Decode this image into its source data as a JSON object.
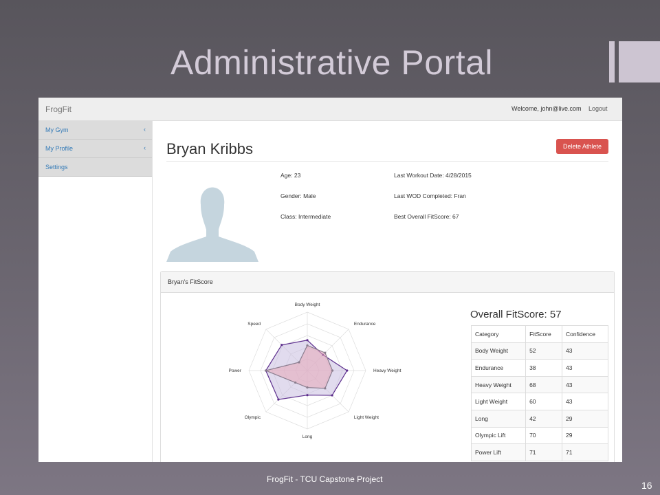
{
  "slide": {
    "title": "Administrative Portal",
    "footer": "FrogFit - TCU Capstone Project",
    "page_number": "16",
    "colors": {
      "accent": "#cdc5d2",
      "background": "#5f5b64"
    }
  },
  "app": {
    "brand": "FrogFit",
    "welcome": "Welcome, john@live.com",
    "logout": "Logout",
    "sidebar": {
      "items": [
        {
          "label": "My Gym",
          "chevron": "‹"
        },
        {
          "label": "My Profile",
          "chevron": "‹"
        },
        {
          "label": "Settings",
          "chevron": ""
        }
      ]
    },
    "athlete": {
      "name": "Bryan Kribbs",
      "delete_label": "Delete Athlete",
      "avatar_icon": "user-silhouette-icon",
      "age": "Age: 23",
      "gender": "Gender: Male",
      "class": "Class: Intermediate",
      "last_workout": "Last Workout Date: 4/28/2015",
      "last_wod": "Last WOD Completed: Fran",
      "best_fitscore": "Best Overall FitScore: 67"
    },
    "fitscore_panel": {
      "heading": "Bryan's FitScore",
      "overall": "Overall FitScore: 57",
      "columns": [
        "Category",
        "FitScore",
        "Confidence"
      ],
      "rows": [
        [
          "Body Weight",
          "52",
          "43"
        ],
        [
          "Endurance",
          "38",
          "43"
        ],
        [
          "Heavy Weight",
          "68",
          "43"
        ],
        [
          "Light Weight",
          "60",
          "43"
        ],
        [
          "Long",
          "42",
          "29"
        ],
        [
          "Olympic Lift",
          "70",
          "29"
        ],
        [
          "Power Lift",
          "71",
          "71"
        ]
      ]
    },
    "radar": {
      "axes": [
        "Body Weight",
        "Endurance",
        "Heavy Weight",
        "Light Weight",
        "Long",
        "Olympic",
        "Power",
        "Speed"
      ],
      "outer_series": [
        0.52,
        0.38,
        0.68,
        0.6,
        0.42,
        0.7,
        0.71,
        0.62
      ],
      "inner_series": [
        0.43,
        0.43,
        0.43,
        0.43,
        0.29,
        0.29,
        0.71,
        0.2
      ],
      "colors": {
        "outer": "#5b2c8c",
        "inner": "#8a7d8e",
        "inner_fill": "#e8a7b8",
        "outer_fill": "#c9bde0"
      }
    }
  }
}
